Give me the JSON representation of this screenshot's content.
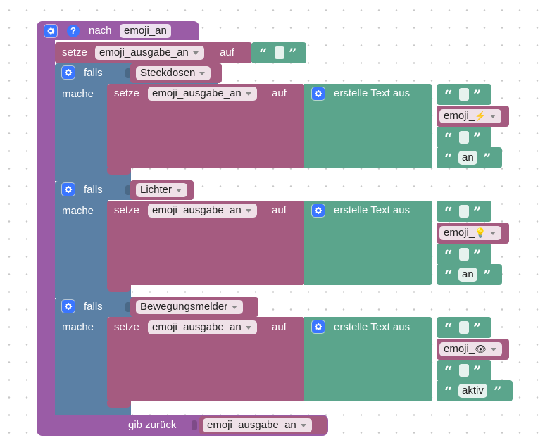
{
  "function": {
    "keyword": "nach",
    "name": "emoji_an",
    "return_keyword": "gib zurück",
    "return_var": "emoji_ausgabe_an"
  },
  "setze_keyword": "setze",
  "auf_keyword": "auf",
  "init": {
    "var": "emoji_ausgabe_an"
  },
  "if_blocks": [
    {
      "falls_label": "falls",
      "condition": "Steckdosen",
      "mache_label": "mache",
      "set_var": "emoji_ausgabe_an",
      "create_text_label": "erstelle Text aus",
      "items": {
        "emoji_var": "emoji_",
        "emoji_icon": "⚡",
        "last_text": "an"
      }
    },
    {
      "falls_label": "falls",
      "condition": "Lichter",
      "mache_label": "mache",
      "set_var": "emoji_ausgabe_an",
      "create_text_label": "erstelle Text aus",
      "items": {
        "emoji_var": "emoji_",
        "emoji_icon": "💡",
        "last_text": "an"
      }
    },
    {
      "falls_label": "falls",
      "condition": "Bewegungsmelder",
      "mache_label": "mache",
      "set_var": "emoji_ausgabe_an",
      "create_text_label": "erstelle Text aus",
      "items": {
        "emoji_var": "emoji_",
        "emoji_icon": "👁",
        "last_text": "aktiv"
      }
    }
  ],
  "icons": {
    "mutator": "gear-icon",
    "help": "question-icon",
    "quote_open": "“",
    "quote_close": "”"
  },
  "colors": {
    "procedure": "#9a5ca6",
    "variables": "#a55b80",
    "logic": "#5b80a5",
    "text": "#5ba58c",
    "mutator_icon": "#3a76ff"
  }
}
